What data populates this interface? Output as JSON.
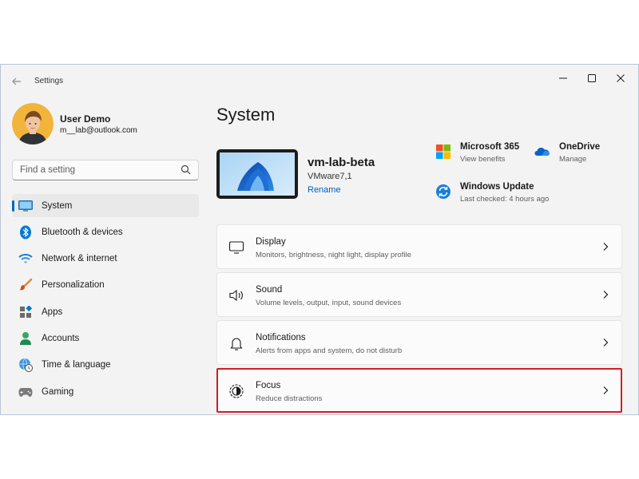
{
  "window": {
    "title": "Settings"
  },
  "profile": {
    "name": "User Demo",
    "email": "m__lab@outlook.com"
  },
  "search": {
    "placeholder": "Find a setting"
  },
  "sidebar": {
    "items": [
      {
        "label": "System",
        "icon": "monitor-icon",
        "active": true
      },
      {
        "label": "Bluetooth & devices",
        "icon": "bluetooth-icon"
      },
      {
        "label": "Network & internet",
        "icon": "wifi-icon"
      },
      {
        "label": "Personalization",
        "icon": "brush-icon"
      },
      {
        "label": "Apps",
        "icon": "apps-icon"
      },
      {
        "label": "Accounts",
        "icon": "person-icon"
      },
      {
        "label": "Time & language",
        "icon": "globe-clock-icon"
      },
      {
        "label": "Gaming",
        "icon": "gamepad-icon"
      }
    ]
  },
  "main": {
    "title": "System",
    "device": {
      "name": "vm-lab-beta",
      "model": "VMware7,1",
      "rename_label": "Rename"
    },
    "quick_links": [
      {
        "title": "Microsoft 365",
        "subtitle": "View benefits",
        "icon": "microsoft-logo-icon"
      },
      {
        "title": "OneDrive",
        "subtitle": "Manage",
        "icon": "onedrive-cloud-icon"
      },
      {
        "title": "Windows Update",
        "subtitle": "Last checked: 4 hours ago",
        "icon": "windows-update-icon"
      }
    ],
    "cards": [
      {
        "title": "Display",
        "subtitle": "Monitors, brightness, night light, display profile",
        "icon": "display-icon"
      },
      {
        "title": "Sound",
        "subtitle": "Volume levels, output, input, sound devices",
        "icon": "speaker-icon"
      },
      {
        "title": "Notifications",
        "subtitle": "Alerts from apps and system, do not disturb",
        "icon": "bell-icon"
      },
      {
        "title": "Focus",
        "subtitle": "Reduce distractions",
        "icon": "focus-icon",
        "highlighted": true
      }
    ]
  },
  "colors": {
    "accent": "#0067c0",
    "link": "#005fb8",
    "highlight_border": "#d11d27",
    "window_bg": "#f3f3f3",
    "card_bg": "#fbfbfb"
  }
}
